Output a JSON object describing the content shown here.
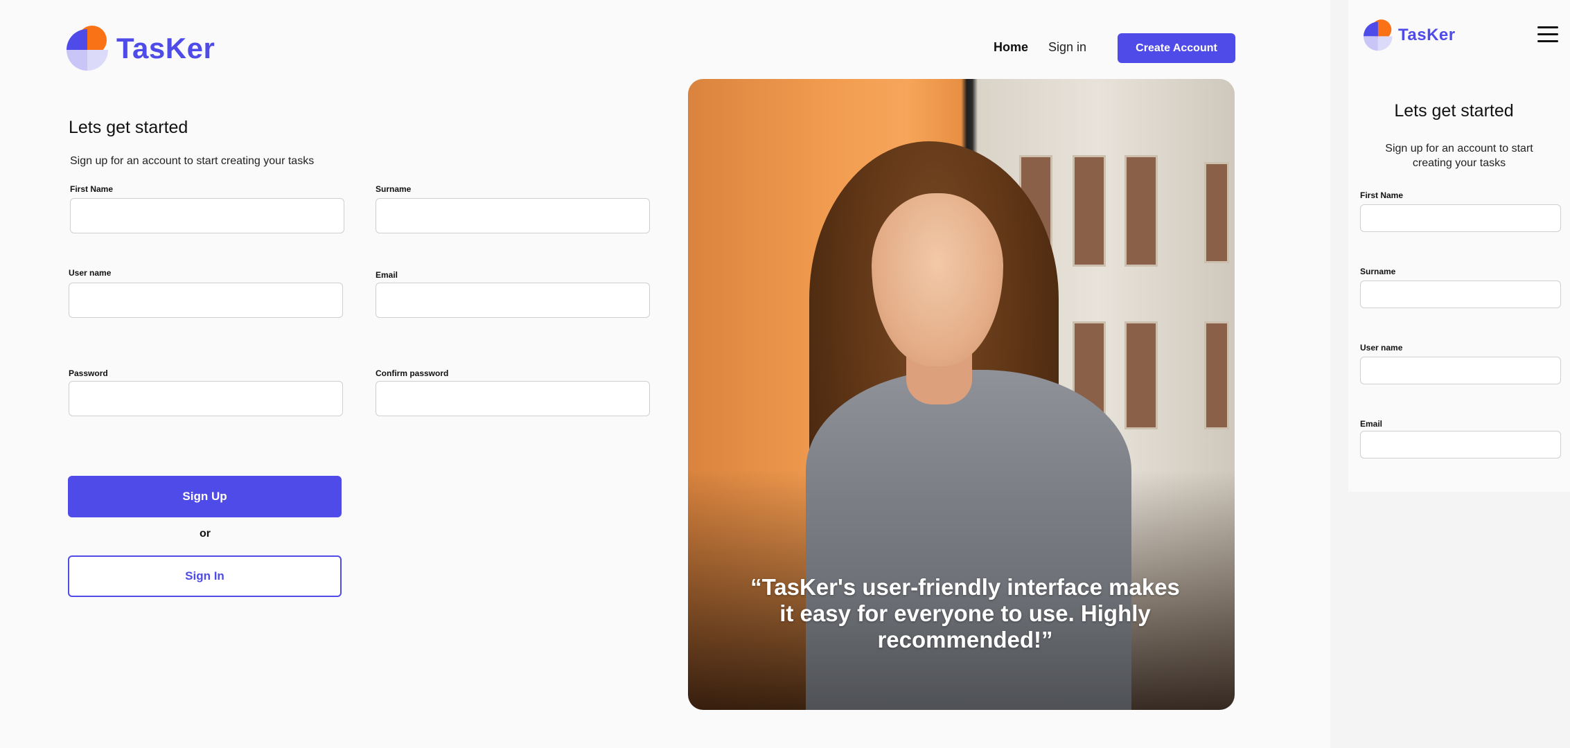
{
  "brand": {
    "name": "TasKer",
    "colors": {
      "primary": "#4f4be8",
      "accent": "#f97316",
      "soft": "#c9c6f7"
    }
  },
  "nav": {
    "home": "Home",
    "signin": "Sign in",
    "create_account": "Create Account"
  },
  "form": {
    "title": "Lets get started",
    "subtitle": "Sign up for an account to start creating your tasks",
    "fields": {
      "first_name": {
        "label": "First Name",
        "value": ""
      },
      "surname": {
        "label": "Surname",
        "value": ""
      },
      "username": {
        "label": "User name",
        "value": ""
      },
      "email": {
        "label": "Email",
        "value": ""
      },
      "password": {
        "label": "Password",
        "value": ""
      },
      "confirm_password": {
        "label": "Confirm password",
        "value": ""
      }
    },
    "signup_button": "Sign Up",
    "or_text": "or",
    "signin_button": "Sign In"
  },
  "testimonial": {
    "quote": "“TasKer's user-friendly interface makes it easy for everyone to use. Highly recommended!”"
  },
  "mobile": {
    "menu_icon": "hamburger-menu-icon"
  }
}
